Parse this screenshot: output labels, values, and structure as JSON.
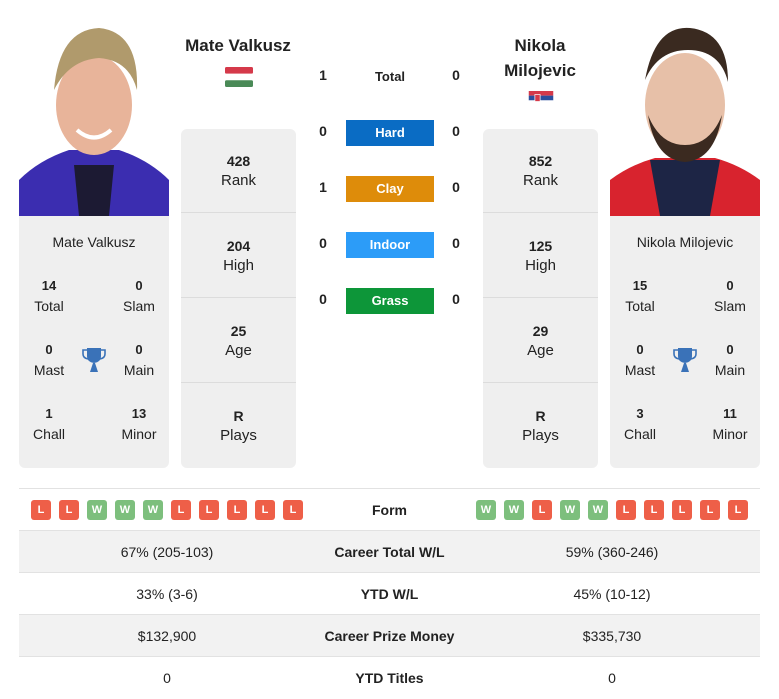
{
  "players": [
    {
      "name": "Mate Valkusz",
      "flag": "hungary-flag",
      "card_name": "Mate Valkusz",
      "titles": {
        "total": {
          "value": "14",
          "label": "Total"
        },
        "slam": {
          "value": "0",
          "label": "Slam"
        },
        "mast": {
          "value": "0",
          "label": "Mast"
        },
        "main": {
          "value": "0",
          "label": "Main"
        },
        "chall": {
          "value": "1",
          "label": "Chall"
        },
        "minor": {
          "value": "13",
          "label": "Minor"
        }
      },
      "stats": [
        {
          "value": "428",
          "label": "Rank"
        },
        {
          "value": "204",
          "label": "High"
        },
        {
          "value": "25",
          "label": "Age"
        },
        {
          "value": "R",
          "label": "Plays"
        }
      ],
      "form": [
        "L",
        "L",
        "W",
        "W",
        "W",
        "L",
        "L",
        "L",
        "L",
        "L"
      ]
    },
    {
      "name": "Nikola Milojevic",
      "name_line1": "Nikola",
      "name_line2": "Milojevic",
      "flag": "serbia-flag",
      "card_name": "Nikola Milojevic",
      "titles": {
        "total": {
          "value": "15",
          "label": "Total"
        },
        "slam": {
          "value": "0",
          "label": "Slam"
        },
        "mast": {
          "value": "0",
          "label": "Mast"
        },
        "main": {
          "value": "0",
          "label": "Main"
        },
        "chall": {
          "value": "3",
          "label": "Chall"
        },
        "minor": {
          "value": "11",
          "label": "Minor"
        }
      },
      "stats": [
        {
          "value": "852",
          "label": "Rank"
        },
        {
          "value": "125",
          "label": "High"
        },
        {
          "value": "29",
          "label": "Age"
        },
        {
          "value": "R",
          "label": "Plays"
        }
      ],
      "form": [
        "W",
        "W",
        "L",
        "W",
        "W",
        "L",
        "L",
        "L",
        "L",
        "L"
      ]
    }
  ],
  "h2h": {
    "total": {
      "label": "Total",
      "left": "1",
      "right": "0"
    },
    "surfaces": [
      {
        "label": "Hard",
        "left": "0",
        "right": "0",
        "color": "#0a6cc4"
      },
      {
        "label": "Clay",
        "left": "1",
        "right": "0",
        "color": "#de8c0a"
      },
      {
        "label": "Indoor",
        "left": "0",
        "right": "0",
        "color": "#2c9cf8"
      },
      {
        "label": "Grass",
        "left": "0",
        "right": "0",
        "color": "#0d9639"
      }
    ]
  },
  "table": {
    "form_label": "Form",
    "rows": [
      {
        "label": "Career Total W/L",
        "left": "67% (205-103)",
        "right": "59% (360-246)"
      },
      {
        "label": "YTD W/L",
        "left": "33% (3-6)",
        "right": "45% (10-12)"
      },
      {
        "label": "Career Prize Money",
        "left": "$132,900",
        "right": "$335,730"
      },
      {
        "label": "YTD Titles",
        "left": "0",
        "right": "0"
      }
    ]
  },
  "colors": {
    "win": "#7dbf7d",
    "loss": "#ee5f48",
    "trophy": "#3a72b8",
    "panel": "#efefef"
  }
}
